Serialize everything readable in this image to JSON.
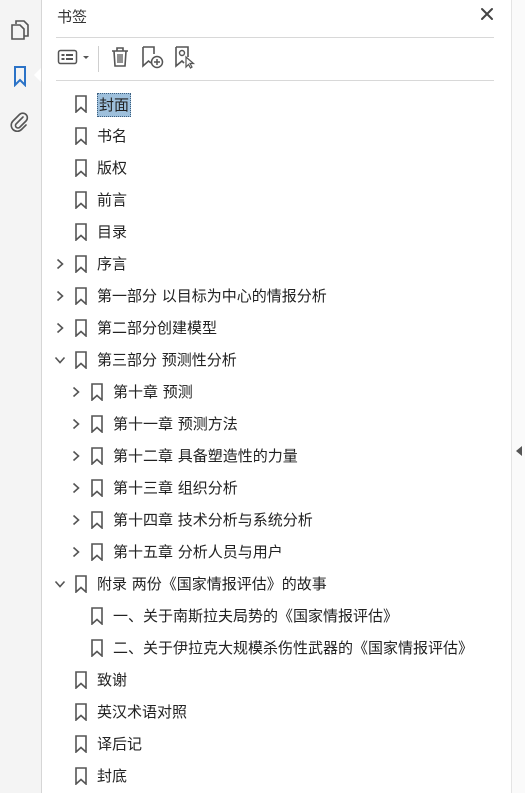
{
  "panel": {
    "title": "书签"
  },
  "rail": {
    "icons": [
      "pages-icon",
      "bookmark-icon",
      "attachment-icon"
    ],
    "active": "bookmark-icon"
  },
  "toolbar": {
    "icons": [
      "options-menu-icon",
      "delete-bookmark-icon",
      "new-bookmark-icon",
      "bookmark-from-selection-icon"
    ]
  },
  "colors": {
    "selection": "#9ec0dc",
    "accent": "#2b73c7"
  },
  "bookmarks": [
    {
      "label": "封面",
      "level": 0,
      "expander": "none",
      "selected": true
    },
    {
      "label": "书名",
      "level": 0,
      "expander": "none"
    },
    {
      "label": "版权",
      "level": 0,
      "expander": "none"
    },
    {
      "label": "前言",
      "level": 0,
      "expander": "none"
    },
    {
      "label": "目录",
      "level": 0,
      "expander": "none"
    },
    {
      "label": "序言",
      "level": 0,
      "expander": "collapsed"
    },
    {
      "label": "第一部分  以目标为中心的情报分析",
      "level": 0,
      "expander": "collapsed"
    },
    {
      "label": "第二部分创建模型",
      "level": 0,
      "expander": "collapsed"
    },
    {
      "label": "第三部分  预测性分析",
      "level": 0,
      "expander": "expanded"
    },
    {
      "label": "第十章  预测",
      "level": 1,
      "expander": "collapsed"
    },
    {
      "label": "第十一章  预测方法",
      "level": 1,
      "expander": "collapsed"
    },
    {
      "label": "第十二章  具备塑造性的力量",
      "level": 1,
      "expander": "collapsed"
    },
    {
      "label": "第十三章  组织分析",
      "level": 1,
      "expander": "collapsed"
    },
    {
      "label": "第十四章  技术分析与系统分析",
      "level": 1,
      "expander": "collapsed"
    },
    {
      "label": "第十五章  分析人员与用户",
      "level": 1,
      "expander": "collapsed"
    },
    {
      "label": "附录  两份《国家情报评估》的故事",
      "level": 0,
      "expander": "expanded"
    },
    {
      "label": "一、关于南斯拉夫局势的《国家情报评估》",
      "level": 1,
      "expander": "none"
    },
    {
      "label": "二、关于伊拉克大规模杀伤性武器的《国家情报评估》",
      "level": 1,
      "expander": "none"
    },
    {
      "label": "致谢",
      "level": 0,
      "expander": "none"
    },
    {
      "label": "英汉术语对照",
      "level": 0,
      "expander": "none"
    },
    {
      "label": "译后记",
      "level": 0,
      "expander": "none"
    },
    {
      "label": "封底",
      "level": 0,
      "expander": "none"
    }
  ]
}
